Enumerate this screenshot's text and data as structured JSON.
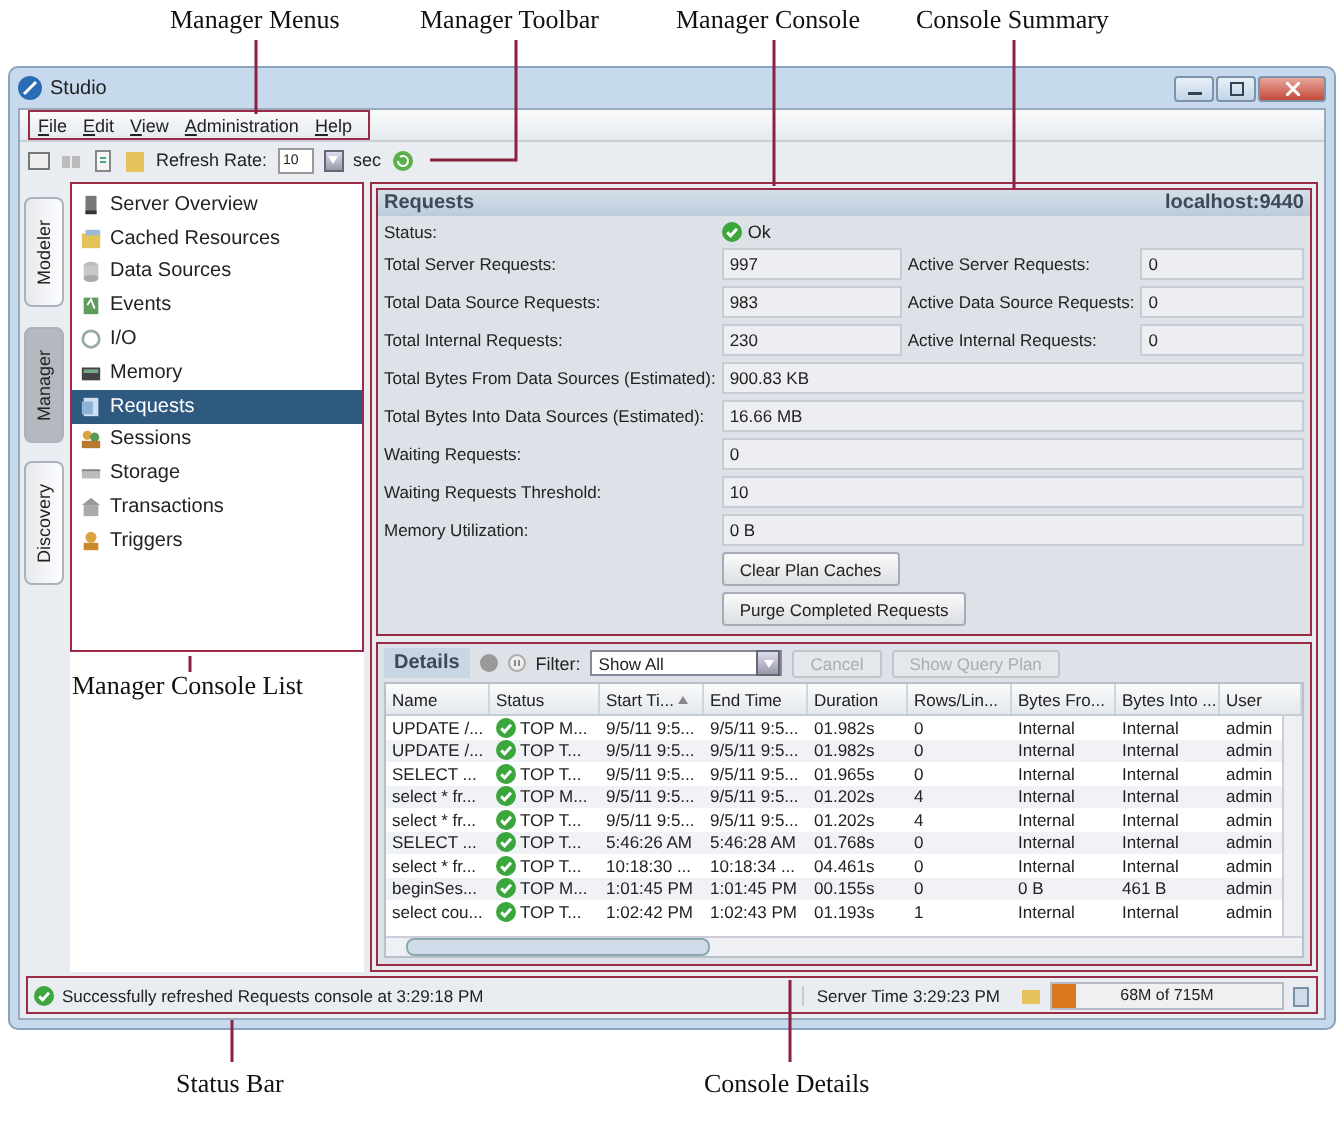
{
  "callouts": [
    {
      "label": "Manager Menus"
    },
    {
      "label": "Manager Toolbar"
    },
    {
      "label": "Manager Console"
    },
    {
      "label": "Console Summary"
    },
    {
      "label": "Manager Console List"
    },
    {
      "label": "Status Bar"
    },
    {
      "label": "Console Details"
    }
  ],
  "window": {
    "title": "Studio"
  },
  "menus": [
    "File",
    "Edit",
    "View",
    "Administration",
    "Help"
  ],
  "toolbar": {
    "refresh_label": "Refresh Rate:",
    "refresh_value": "10",
    "unit": "sec"
  },
  "side_tabs": [
    {
      "label": "Modeler",
      "selected": false
    },
    {
      "label": "Manager",
      "selected": true
    },
    {
      "label": "Discovery",
      "selected": false
    }
  ],
  "console_list": [
    {
      "label": "Server Overview",
      "selected": false
    },
    {
      "label": "Cached Resources",
      "selected": false
    },
    {
      "label": "Data Sources",
      "selected": false
    },
    {
      "label": "Events",
      "selected": false
    },
    {
      "label": "I/O",
      "selected": false
    },
    {
      "label": "Memory",
      "selected": false
    },
    {
      "label": "Requests",
      "selected": true
    },
    {
      "label": "Sessions",
      "selected": false
    },
    {
      "label": "Storage",
      "selected": false
    },
    {
      "label": "Transactions",
      "selected": false
    },
    {
      "label": "Triggers",
      "selected": false
    }
  ],
  "summary": {
    "title": "Requests",
    "host": "localhost:9440",
    "status_label": "Status:",
    "status_value": "Ok",
    "rows": [
      {
        "label": "Total Server Requests:",
        "value": "997",
        "label_2": "Active Server Requests:",
        "value_2": "0"
      },
      {
        "label": "Total Data Source Requests:",
        "value": "983",
        "label_2": "Active Data Source Requests:",
        "value_2": "0"
      },
      {
        "label": "Total Internal Requests:",
        "value": "230",
        "label_2": "Active Internal Requests:",
        "value_2": "0"
      },
      {
        "label": "Total Bytes From Data Sources (Estimated):",
        "value": "900.83 KB"
      },
      {
        "label": "Total Bytes Into Data Sources (Estimated):",
        "value": "16.66 MB"
      },
      {
        "label": "Waiting Requests:",
        "value": "0"
      },
      {
        "label": "Waiting Requests Threshold:",
        "value": "10"
      },
      {
        "label": "Memory Utilization:",
        "value": "0 B"
      }
    ],
    "buttons": [
      "Clear Plan Caches",
      "Purge Completed Requests"
    ]
  },
  "details": {
    "title": "Details",
    "filter_label": "Filter:",
    "filter_value": "Show All",
    "buttons": [
      {
        "label": "Cancel",
        "disabled": true
      },
      {
        "label": "Show Query Plan",
        "disabled": true
      }
    ],
    "columns": [
      "Name",
      "Status",
      "Start Ti...",
      "End Time",
      "Duration",
      "Rows/Lin...",
      "Bytes Fro...",
      "Bytes Into ...",
      "User"
    ],
    "rows": [
      [
        "UPDATE /...",
        "TOP M...",
        "9/5/11 9:5...",
        "9/5/11 9:5...",
        "01.982s",
        "0",
        "Internal",
        "Internal",
        "admin"
      ],
      [
        "UPDATE /...",
        "TOP T...",
        "9/5/11 9:5...",
        "9/5/11 9:5...",
        "01.982s",
        "0",
        "Internal",
        "Internal",
        "admin"
      ],
      [
        "SELECT ...",
        "TOP T...",
        "9/5/11 9:5...",
        "9/5/11 9:5...",
        "01.965s",
        "0",
        "Internal",
        "Internal",
        "admin"
      ],
      [
        "select * fr...",
        "TOP M...",
        "9/5/11 9:5...",
        "9/5/11 9:5...",
        "01.202s",
        "4",
        "Internal",
        "Internal",
        "admin"
      ],
      [
        "select * fr...",
        "TOP T...",
        "9/5/11 9:5...",
        "9/5/11 9:5...",
        "01.202s",
        "4",
        "Internal",
        "Internal",
        "admin"
      ],
      [
        "SELECT ...",
        "TOP T...",
        "5:46:26 AM",
        "5:46:28 AM",
        "01.768s",
        "0",
        "Internal",
        "Internal",
        "admin"
      ],
      [
        "select * fr...",
        "TOP T...",
        "10:18:30 ...",
        "10:18:34 ...",
        "04.461s",
        "0",
        "Internal",
        "Internal",
        "admin"
      ],
      [
        "beginSes...",
        "TOP M...",
        "1:01:45 PM",
        "1:01:45 PM",
        "00.155s",
        "0",
        "0 B",
        "461 B",
        "admin"
      ],
      [
        "select cou...",
        "TOP T...",
        "1:02:42 PM",
        "1:02:43 PM",
        "01.193s",
        "1",
        "Internal",
        "Internal",
        "admin"
      ]
    ]
  },
  "status_bar": {
    "message": "Successfully refreshed Requests console at 3:29:18 PM",
    "server_time": "Server Time 3:29:23 PM",
    "memory": {
      "text": "68M of 715M",
      "level": 0.1
    }
  }
}
